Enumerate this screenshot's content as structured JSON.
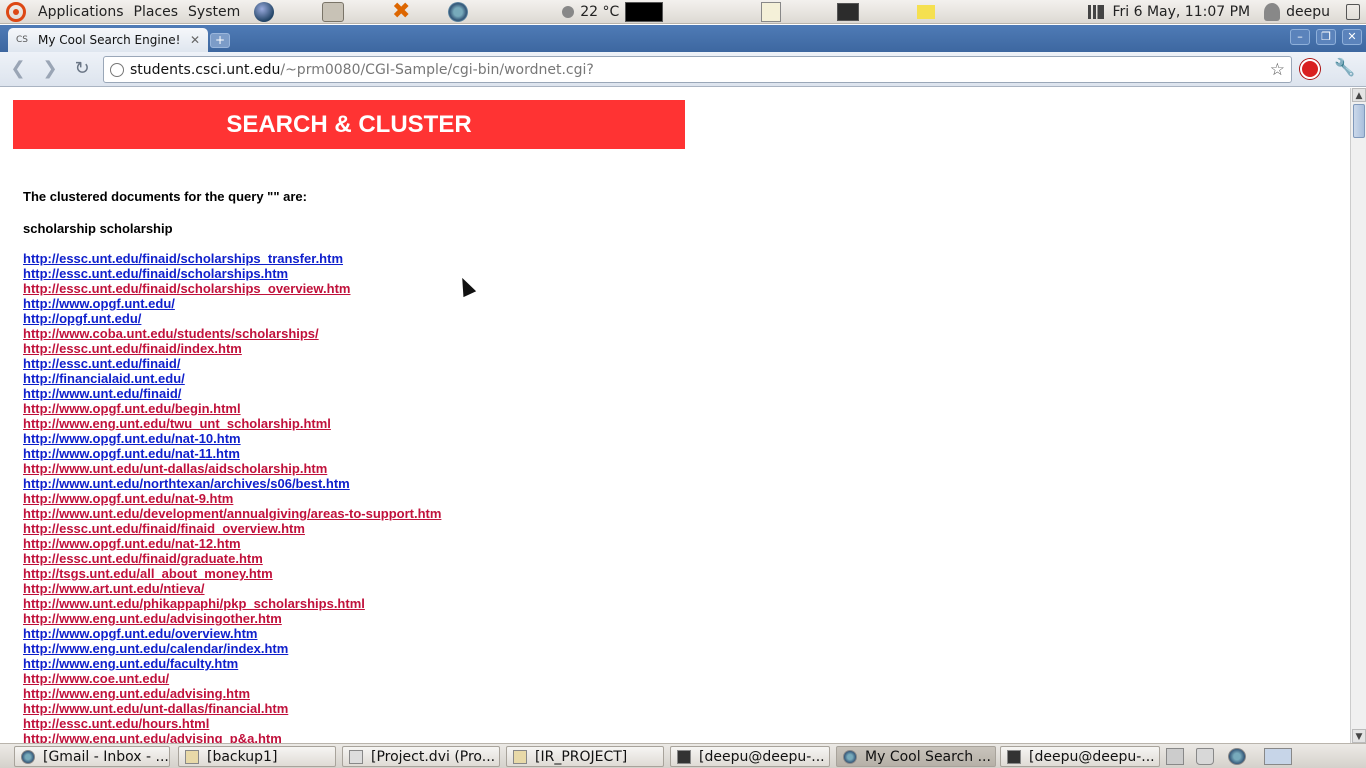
{
  "top_panel": {
    "menus": [
      "Applications",
      "Places",
      "System"
    ],
    "temperature": "22 °C",
    "datetime": "Fri  6 May, 11:07 PM",
    "username": "deepu"
  },
  "browser": {
    "tab_title": "My Cool Search Engine!",
    "tab_favicon_text": "CS",
    "url_host": "students.csci.unt.edu",
    "url_path": "/~prm0080/CGI-Sample/cgi-bin/wordnet.cgi?"
  },
  "page": {
    "banner": "SEARCH & CLUSTER",
    "intro": "The clustered documents for the query \"\" are:",
    "cluster_name": "scholarship scholarship",
    "links": [
      {
        "text": "http://essc.unt.edu/finaid/scholarships_transfer.htm",
        "color": "#1020cc"
      },
      {
        "text": "http://essc.unt.edu/finaid/scholarships.htm",
        "color": "#1020cc"
      },
      {
        "text": "http://essc.unt.edu/finaid/scholarships_overview.htm",
        "color": "#c0113b"
      },
      {
        "text": "http://www.opgf.unt.edu/",
        "color": "#1020cc"
      },
      {
        "text": "http://opgf.unt.edu/",
        "color": "#1020cc"
      },
      {
        "text": "http://www.coba.unt.edu/students/scholarships/",
        "color": "#c0113b"
      },
      {
        "text": "http://essc.unt.edu/finaid/index.htm",
        "color": "#c0113b"
      },
      {
        "text": "http://essc.unt.edu/finaid/",
        "color": "#1020cc"
      },
      {
        "text": "http://financialaid.unt.edu/",
        "color": "#1020cc"
      },
      {
        "text": "http://www.unt.edu/finaid/",
        "color": "#1020cc"
      },
      {
        "text": "http://www.opgf.unt.edu/begin.html",
        "color": "#c0113b"
      },
      {
        "text": "http://www.eng.unt.edu/twu_unt_scholarship.html",
        "color": "#c0113b"
      },
      {
        "text": "http://www.opgf.unt.edu/nat-10.htm",
        "color": "#1020cc"
      },
      {
        "text": "http://www.opgf.unt.edu/nat-11.htm",
        "color": "#1020cc"
      },
      {
        "text": "http://www.unt.edu/unt-dallas/aidscholarship.htm",
        "color": "#c0113b"
      },
      {
        "text": "http://www.unt.edu/northtexan/archives/s06/best.htm",
        "color": "#1020cc"
      },
      {
        "text": "http://www.opgf.unt.edu/nat-9.htm",
        "color": "#c0113b"
      },
      {
        "text": "http://www.unt.edu/development/annualgiving/areas-to-support.htm",
        "color": "#c0113b"
      },
      {
        "text": "http://essc.unt.edu/finaid/finaid_overview.htm",
        "color": "#c0113b"
      },
      {
        "text": "http://www.opgf.unt.edu/nat-12.htm",
        "color": "#c0113b"
      },
      {
        "text": "http://essc.unt.edu/finaid/graduate.htm",
        "color": "#c0113b"
      },
      {
        "text": "http://tsgs.unt.edu/all_about_money.htm",
        "color": "#c0113b"
      },
      {
        "text": "http://www.art.unt.edu/ntieva/",
        "color": "#c0113b"
      },
      {
        "text": "http://www.unt.edu/phikappaphi/pkp_scholarships.html",
        "color": "#c0113b"
      },
      {
        "text": "http://www.eng.unt.edu/advisingother.htm",
        "color": "#c0113b"
      },
      {
        "text": "http://www.opgf.unt.edu/overview.htm",
        "color": "#1020cc"
      },
      {
        "text": "http://www.eng.unt.edu/calendar/index.htm",
        "color": "#1020cc"
      },
      {
        "text": "http://www.eng.unt.edu/faculty.htm",
        "color": "#1020cc"
      },
      {
        "text": "http://www.coe.unt.edu/",
        "color": "#c0113b"
      },
      {
        "text": "http://www.eng.unt.edu/advising.htm",
        "color": "#c0113b"
      },
      {
        "text": "http://www.unt.edu/unt-dallas/financial.htm",
        "color": "#c0113b"
      },
      {
        "text": "http://essc.unt.edu/hours.html",
        "color": "#c0113b"
      },
      {
        "text": "http://www.eng.unt.edu/advising_p&a.htm",
        "color": "#c0113b"
      }
    ]
  },
  "taskbar": {
    "tasks": [
      {
        "label": "[Gmail - Inbox - ...",
        "icon": "chrome-icon",
        "active": false
      },
      {
        "label": "[backup1]",
        "icon": "folder-icon",
        "active": false
      },
      {
        "label": "[Project.dvi (Pro...",
        "icon": "document-icon",
        "active": false
      },
      {
        "label": "[IR_PROJECT]",
        "icon": "folder-icon",
        "active": false
      },
      {
        "label": "[deepu@deepu-...",
        "icon": "terminal-icon",
        "active": false
      },
      {
        "label": "My Cool Search ...",
        "icon": "chrome-icon",
        "active": true
      },
      {
        "label": "[deepu@deepu-...",
        "icon": "terminal-icon",
        "active": false
      }
    ]
  }
}
